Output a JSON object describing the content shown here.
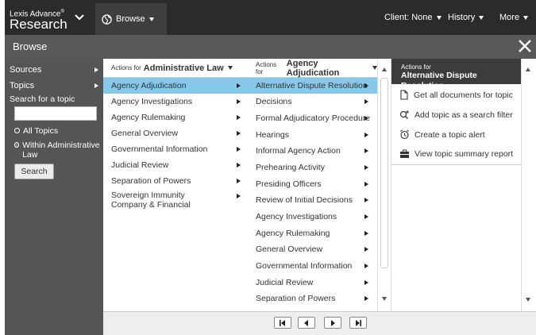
{
  "header": {
    "brand_line1": "Lexis Advance",
    "brand_reg": "®",
    "brand_line2": "Research",
    "browse_label": "Browse",
    "client_label": "Client: None",
    "history_label": "History",
    "more_label": "More"
  },
  "browse_bar": {
    "title": "Browse",
    "close_icon": "close-icon"
  },
  "sidebar": {
    "items": [
      {
        "label": "Sources"
      },
      {
        "label": "Topics"
      }
    ],
    "search_label": "Search for a topic",
    "search_value": "",
    "radio_all": "All Topics",
    "radio_within": "Within Administrative Law",
    "search_button": "Search"
  },
  "column1": {
    "header_prefix": "Actions for",
    "header_topic": "Administrative Law",
    "items": [
      "Agency Adjudication",
      "Agency Investigations",
      "Agency Rulemaking",
      "General Overview",
      "Governmental Information",
      "Judicial Review",
      "Separation of Powers",
      "Sovereign Immunity Company & Financial"
    ],
    "selected": "Agency Adjudication"
  },
  "column2": {
    "header_prefix": "Actions for",
    "header_topic": "Agency Adjudication",
    "items": [
      "Alternative Dispute Resolution",
      "Decisions",
      "Formal Adjudicatory Procedure",
      "Hearings",
      "Informal Agency Action",
      "Prehearing Activity",
      "Presiding Officers",
      "Review of Initial Decisions",
      "Agency Investigations",
      "Agency Rulemaking",
      "General Overview",
      "Governmental Information",
      "Judicial Review",
      "Separation of Powers"
    ],
    "selected": "Alternative Dispute Resolution"
  },
  "actions_panel": {
    "header_prefix": "Actions for",
    "header_topic": "Alternative Dispute Resolution",
    "actions": [
      {
        "label": "Get all documents for topic",
        "icon": "document-icon"
      },
      {
        "label": "Add topic as a search filter",
        "icon": "search-plus-icon"
      },
      {
        "label": "Create a topic alert",
        "icon": "alarm-clock-icon"
      },
      {
        "label": "View topic summary report",
        "icon": "briefcase-icon"
      }
    ]
  },
  "pager": {
    "buttons": [
      "first-page-icon",
      "prev-page-icon",
      "next-page-icon",
      "last-page-icon"
    ]
  },
  "colors": {
    "topbar": "#2b2b2b",
    "browse_bar": "#585858",
    "sidebar": "#555555",
    "selection": "#87c9ea"
  }
}
